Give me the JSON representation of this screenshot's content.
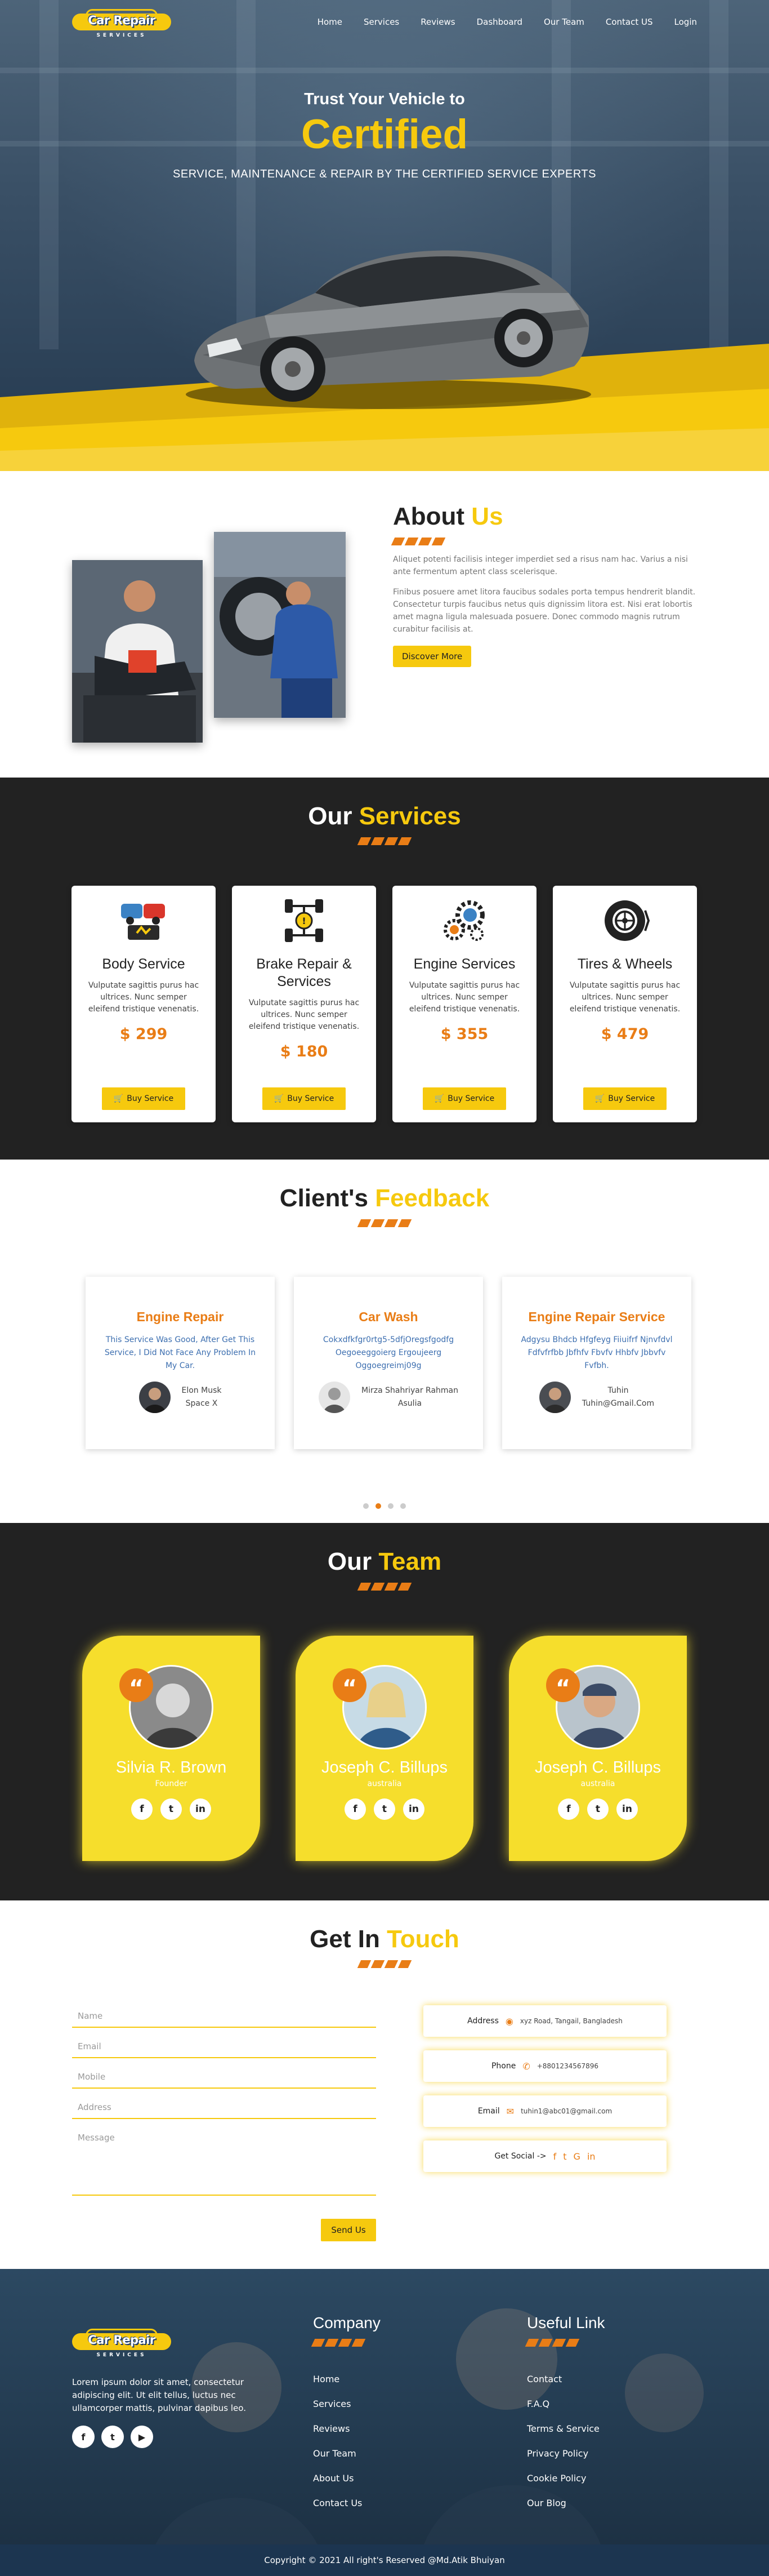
{
  "nav": {
    "logo_main": "Car Repair",
    "logo_sub": "SERVICES",
    "items": [
      "Home",
      "Services",
      "Reviews",
      "Dashboard",
      "Our Team",
      "Contact US",
      "Login"
    ]
  },
  "hero": {
    "title": "Trust Your Vehicle to",
    "highlight": "Certified",
    "subtitle": "SERVICE, MAINTENANCE & REPAIR BY THE CERTIFIED SERVICE EXPERTS"
  },
  "about": {
    "title": "About",
    "title_highlight": "Us",
    "para1": "Aliquet potenti facilisis integer imperdiet sed a risus nam hac. Varius a nisi ante fermentum aptent class scelerisque.",
    "para2": "Finibus posuere amet litora faucibus sodales porta tempus hendrerit blandit. Consectetur turpis faucibus netus quis dignissim litora est. Nisi erat lobortis amet magna ligula malesuada posuere. Donec commodo magnis rutrum curabitur facilisis at.",
    "button": "Discover More"
  },
  "services": {
    "title": "Our",
    "title_highlight": "Services",
    "cards": [
      {
        "icon": "car-body-icon",
        "title": "Body Service",
        "text": "Vulputate sagittis purus hac ultrices. Nunc semper eleifend tristique venenatis.",
        "price": "$ 299",
        "button": "Buy Service"
      },
      {
        "icon": "brake-icon",
        "title": "Brake Repair & Services",
        "text": "Vulputate sagittis purus hac ultrices. Nunc semper eleifend tristique venenatis.",
        "price": "$ 180",
        "button": "Buy Service"
      },
      {
        "icon": "engine-gears-icon",
        "title": "Engine Services",
        "text": "Vulputate sagittis purus hac ultrices. Nunc semper eleifend tristique venenatis.",
        "price": "$ 355",
        "button": "Buy Service"
      },
      {
        "icon": "tire-icon",
        "title": "Tires & Wheels",
        "text": "Vulputate sagittis purus hac ultrices. Nunc semper eleifend tristique venenatis.",
        "price": "$ 479",
        "button": "Buy Service"
      }
    ]
  },
  "feedback": {
    "title": "Client's",
    "title_highlight": "Feedback",
    "items": [
      {
        "service": "Engine Repair",
        "text": "This Service Was Good, After Get This Service, I Did Not Face Any Problem In My Car.",
        "name": "Elon Musk",
        "org": "Space X"
      },
      {
        "service": "Car Wash",
        "text": "Cokxdfkfgr0rtg5-5dfjOregsfgodfg Oegoeeggoierg Ergoujeerg Oggoegreimj09g",
        "name": "Mirza Shahriyar Rahman",
        "org": "Asulia"
      },
      {
        "service": "Engine Repair Service",
        "text": "Adgysu Bhdcb Hfgfeyg Fiiuifrf Njnvfdvl Fdfvfrfbb Jbfhfv Fbvfv Hhbfv Jbbvfv Fvfbh.",
        "name": "Tuhin",
        "org": "Tuhin@Gmail.Com"
      }
    ]
  },
  "team": {
    "title": "Our",
    "title_highlight": "Team",
    "members": [
      {
        "name": "Silvia R. Brown",
        "role": "Founder"
      },
      {
        "name": "Joseph C. Billups",
        "role": "australia"
      },
      {
        "name": "Joseph C. Billups",
        "role": "australia"
      }
    ]
  },
  "contact": {
    "title": "Get In",
    "title_highlight": "Touch",
    "name_placeholder": "Name",
    "email_placeholder": "Email",
    "mobile_placeholder": "Mobile",
    "address_placeholder": "Address",
    "message_placeholder": "Message",
    "send": "Send Us",
    "address_label": "Address",
    "address_value": "xyz Road, Tangail, Bangladesh",
    "phone_label": "Phone",
    "phone_value": "+8801234567896",
    "email_label": "Email",
    "email_value": "tuhin1@abc01@gmail.com",
    "social_label": "Get Social ->"
  },
  "footer": {
    "logo_main": "Car Repair",
    "logo_sub": "SERVICES",
    "text": "Lorem ipsum dolor sit amet, consectetur adipiscing elit. Ut elit tellus, luctus nec ullamcorper mattis, pulvinar dapibus leo.",
    "company_title": "Company",
    "company_links": [
      "Home",
      "Services",
      "Reviews",
      "Our Team",
      "About Us",
      "Contact Us"
    ],
    "useful_title": "Useful Link",
    "useful_links": [
      "Contact",
      "F.A.Q",
      "Terms & Service",
      "Privacy Policy",
      "Cookie Policy",
      "Our Blog"
    ],
    "copyright": "Copyright © 2021 All right's Reserved @Md.Atik Bhuiyan"
  },
  "colors": {
    "accent": "#f6c90e",
    "orange": "#e97d16",
    "dark": "#222222"
  }
}
